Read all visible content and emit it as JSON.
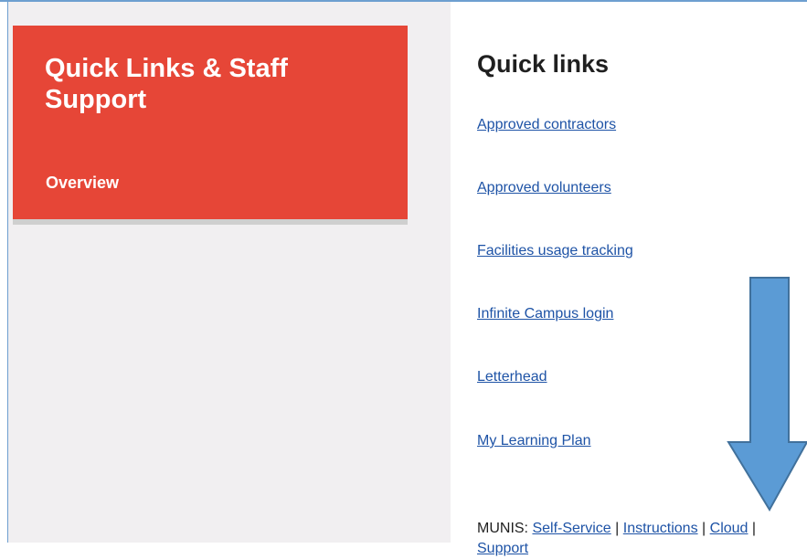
{
  "sidebar_card": {
    "title": "Quick Links & Staff Support",
    "subtitle": "Overview"
  },
  "quick_links": {
    "heading": "Quick links",
    "links": [
      "Approved contractors",
      "Approved volunteers",
      "Facilities usage tracking",
      "Infinite Campus login",
      "Letterhead",
      "My Learning Plan"
    ]
  },
  "munis": {
    "label": "MUNIS:",
    "self_service": "Self-Service",
    "instructions": "Instructions",
    "cloud": "Cloud",
    "support": "Support",
    "separator": "|"
  },
  "annotation": {
    "arrow_color": "#5b9bd5",
    "arrow_icon": "down-arrow-icon"
  },
  "colors": {
    "card_red": "#e64637",
    "link_blue": "#1e53a6",
    "panel_gray": "#f1eff1"
  }
}
